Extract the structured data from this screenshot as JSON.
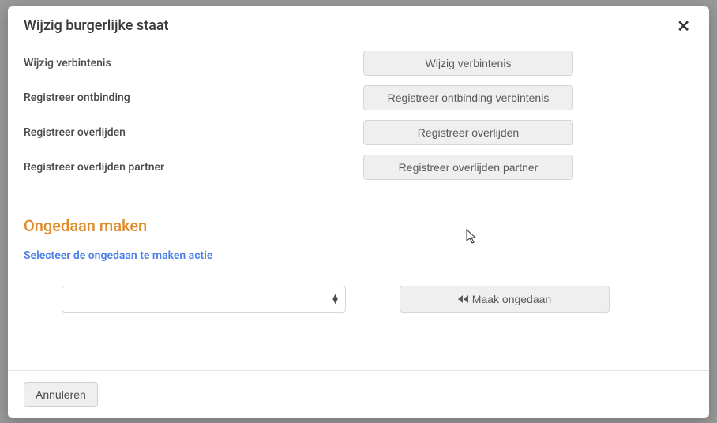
{
  "modal": {
    "title": "Wijzig burgerlijke staat",
    "rows": [
      {
        "label": "Wijzig verbintenis",
        "button": "Wijzig verbintenis"
      },
      {
        "label": "Registreer ontbinding",
        "button": "Registreer ontbinding verbintenis"
      },
      {
        "label": "Registreer overlijden",
        "button": "Registreer overlijden"
      },
      {
        "label": "Registreer overlijden partner",
        "button": "Registreer overlijden partner"
      }
    ],
    "undo": {
      "section_title": "Ongedaan maken",
      "subtitle": "Selecteer de ongedaan te maken actie",
      "select_value": "",
      "undo_button": "Maak ongedaan"
    },
    "footer": {
      "cancel": "Annuleren"
    }
  }
}
